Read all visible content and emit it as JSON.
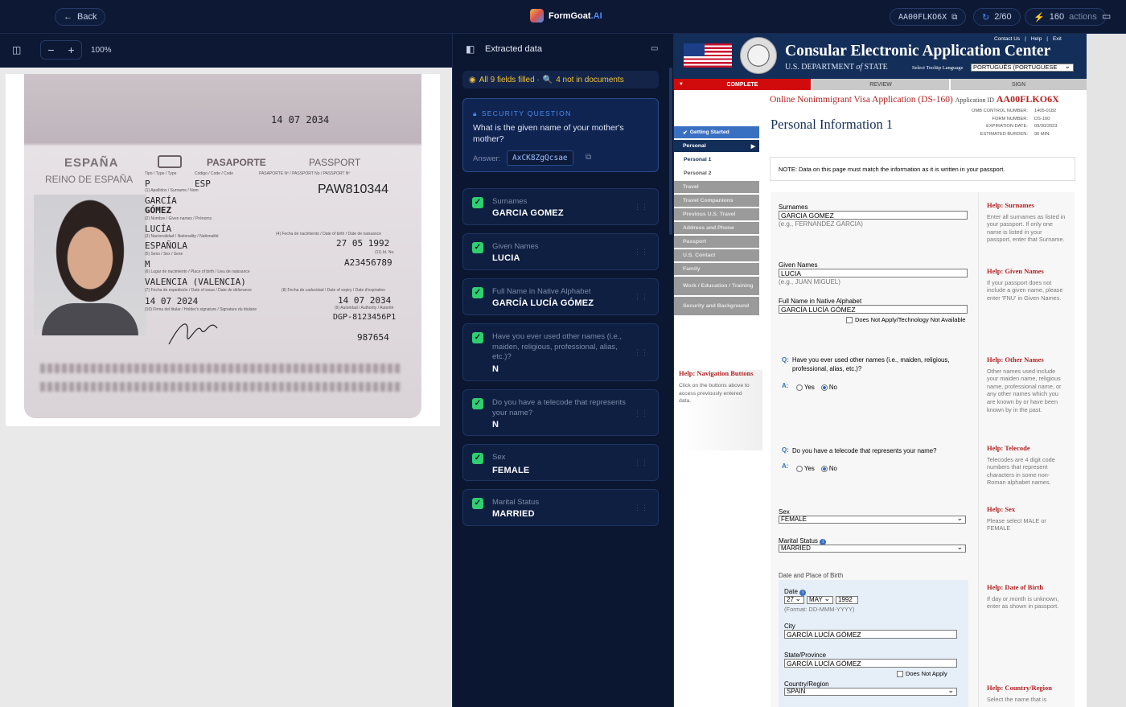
{
  "topbar": {
    "back_label": "Back",
    "brand_a": "FormGoat",
    "brand_b": ".AI",
    "app_id": "AA00FLKO6X",
    "progress": "2/60",
    "actions_count": "160",
    "actions_label": "actions"
  },
  "viewer": {
    "zoom_minus": "−",
    "zoom_plus": "+",
    "zoom_level": "100%"
  },
  "passport": {
    "mrz_top_date": "14 07 2034",
    "espana": "ESPAÑA",
    "reino": "REINO DE ESPAÑA",
    "pasaporte": "PASAPORTE",
    "passport_word": "PASSPORT",
    "lbl_type": "Tipo / Type / Type",
    "lbl_code": "Código / Code / Code",
    "lbl_passno": "PASAPORTE Nº / PASSPORT No / PASSPORT Nº",
    "type": "P",
    "code": "ESP",
    "passport_no": "PAW810344",
    "lbl_surname": "(1) Apellidos / Surname / Nom",
    "surname1": "GARCÍA",
    "surname2": "GÓMEZ",
    "lbl_given": "(2) Nombre / Given names / Prénoms",
    "given": "LUCÍA",
    "lbl_nationality": "(3) Nacionalidad / Nationality / Nationalité",
    "lbl_dob": "(4) Fecha de nacimiento / Date of birth / Date de naissance",
    "nationality": "ESPAÑOLA",
    "dob": "27 05 1992",
    "lbl_id": "(11) Id. No.",
    "lbl_sex": "(5) Sexo / Sex / Sexe",
    "sex": "M",
    "id_no": "A23456789",
    "lbl_pob": "(6) Lugar de nacimiento / Place of birth / Lieu de naissance",
    "pob": "VALENCIA (VALENCIA)",
    "lbl_issue": "(7) Fecha de expedición / Date of issue / Date de délivrance",
    "lbl_expiry": "(8) Fecha de caducidad / Date of expiry / Date d'expiration",
    "issue": "14 07 2024",
    "expiry": "14 07 2034",
    "lbl_signature": "(10) Firma del titular / Holder's signature / Signature du titulaire",
    "lbl_authority": "(9) Autoridad / Authority / Autorité",
    "authority": "DGP-8123456P1",
    "serial": "987654"
  },
  "extracted": {
    "title": "Extracted data",
    "banner_filled": "All 9 fields filled ·",
    "banner_missing": "4 not in documents",
    "security": {
      "heading": "SECURITY QUESTION",
      "question": "What is the given name of your mother's mother?",
      "answer_label": "Answer:",
      "answer": "AxCK8ZgQcsae"
    },
    "fields": [
      {
        "label": "Surnames",
        "value": "GARCIA GOMEZ"
      },
      {
        "label": "Given Names",
        "value": "LUCIA"
      },
      {
        "label": "Full Name in Native Alphabet",
        "value": "GARCÍA LUCÍA GÓMEZ"
      },
      {
        "label": "Have you ever used other names (i.e., maiden, religious, professional, alias, etc.)?",
        "value": "N"
      },
      {
        "label": "Do you have a telecode that represents your name?",
        "value": "N"
      },
      {
        "label": "Sex",
        "value": "FEMALE"
      },
      {
        "label": "Marital Status",
        "value": "MARRIED"
      }
    ]
  },
  "ceac": {
    "title": "Consular Electronic Application Center",
    "dept_a": "U.S. DEPARTMENT",
    "dept_of": "of",
    "dept_b": "STATE",
    "links": [
      "Contact Us",
      "Help",
      "Exit"
    ],
    "tooltip_label": "Select Tooltip Language",
    "tooltip_value": "PORTUGUÊS (PORTUGUESE",
    "nav": [
      "COMPLETE",
      "REVIEW",
      "SIGN"
    ],
    "app_title": "Online Nonimmigrant Visa Application (DS-160)",
    "app_id_label": "Application ID",
    "app_id": "AA00FLKO6X",
    "omb": [
      {
        "k": "OMB CONTROL NUMBER:",
        "v": "1405-0182"
      },
      {
        "k": "FORM NUMBER:",
        "v": "DS-160"
      },
      {
        "k": "EXPIRATION DATE:",
        "v": "09/30/2023"
      },
      {
        "k": "ESTIMATED BURDEN:",
        "v": "90 MIN"
      }
    ],
    "page_title": "Personal Information 1",
    "note": "NOTE: Data on this page must match the information as it is written in your passport.",
    "sidebar": [
      "Getting Started",
      "Personal",
      "Personal 1",
      "Personal 2",
      "Travel",
      "Travel Companions",
      "Previous U.S. Travel",
      "Address and Phone",
      "Passport",
      "U.S. Contact",
      "Family",
      "Work / Education / Training",
      "Security and Background"
    ],
    "nav_help_title": "Help: Navigation Buttons",
    "nav_help_text": "Click on the buttons above to access previously entered data.",
    "surnames_label": "Surnames",
    "surnames_value": "GARCIA GOMEZ",
    "surnames_hint": "(e.g., FERNANDEZ GARCIA)",
    "given_label": "Given Names",
    "given_value": "LUCIA",
    "given_hint": "(e.g., JUAN MIGUEL)",
    "native_label": "Full Name in Native Alphabet",
    "native_value": "GARCÍA LUCÍA GÓMEZ",
    "native_na": "Does Not Apply/Technology Not Available",
    "other_q": "Have you ever used other names (i.e., maiden, religious, professional, alias, etc.)?",
    "telecode_q": "Do you have a telecode that represents your name?",
    "q_mark": "Q:",
    "a_mark": "A:",
    "yes": "Yes",
    "no": "No",
    "sex_label": "Sex",
    "sex_value": "FEMALE",
    "marital_label": "Marital Status",
    "marital_value": "MARRIED",
    "dob_section": "Date and Place of Birth",
    "date_label": "Date",
    "dob_day": "27",
    "dob_month": "MAY",
    "dob_year": "1992",
    "dob_format": "(Format: DD-MMM-YYYY)",
    "city_label": "City",
    "city_value": "GARCÍA LUCÍA GÓMEZ",
    "state_label": "State/Province",
    "state_value": "GARCÍA LUCÍA GÓMEZ",
    "state_na": "Does Not Apply",
    "country_label": "Country/Region",
    "country_value": "SPAIN",
    "help": [
      {
        "title": "Help: Surnames",
        "text": "Enter all surnames as listed in your passport. If only one name is listed in your passport, enter that Surname."
      },
      {
        "title": "Help: Given Names",
        "text": "If your passport does not include a given name, please enter 'FNU' in Given Names."
      },
      {
        "title": "Help: Other Names",
        "text": "Other names used include your maiden name, religious name, professional name, or any other names which you are known by or have been known by in the past."
      },
      {
        "title": "Help: Telecode",
        "text": "Telecodes are 4 digit code numbers that represent characters in some non-Roman alphabet names."
      },
      {
        "title": "Help: Sex",
        "text": "Please select MALE or FEMALE"
      },
      {
        "title": "Help: Date of Birth",
        "text": "If day or month is unknown, enter as shown in passport."
      },
      {
        "title": "Help: Country/Region",
        "text": "Select the name that is"
      }
    ]
  }
}
